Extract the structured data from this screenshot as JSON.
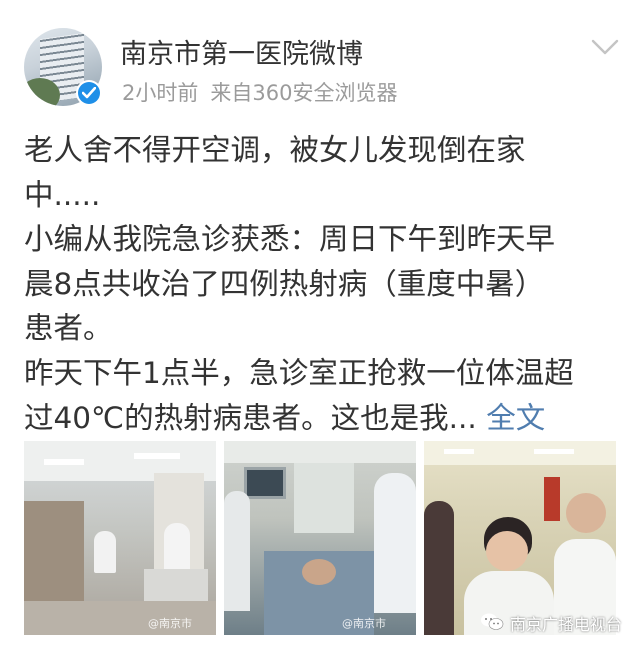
{
  "post": {
    "author": "南京市第一医院微博",
    "time": "2小时前",
    "source": "来自360安全浏览器",
    "lines": [
      "老人舍不得开空调，被女儿发现倒在家",
      "中.....",
      "小编从我院急诊获悉：周日下午到昨天早",
      "晨8点共收治了四例热射病（重度中暑）",
      "患者。",
      "昨天下午1点半，急诊室正抢救一位体温超"
    ],
    "last_line": "过40℃的热射病患者。这也是我...",
    "full_text_link": "全文"
  },
  "photos": {
    "watermark_small": "@南京市",
    "watermark_big": "南京广播电视台"
  },
  "icons": {
    "avatar": "hospital-building-avatar",
    "verified": "verified-badge-icon",
    "menu": "chevron-down-icon",
    "wechat": "wechat-icon"
  },
  "colors": {
    "link": "#507daf",
    "meta": "#9b9b9b",
    "text": "#333333",
    "verified": "#1e8fe8"
  }
}
